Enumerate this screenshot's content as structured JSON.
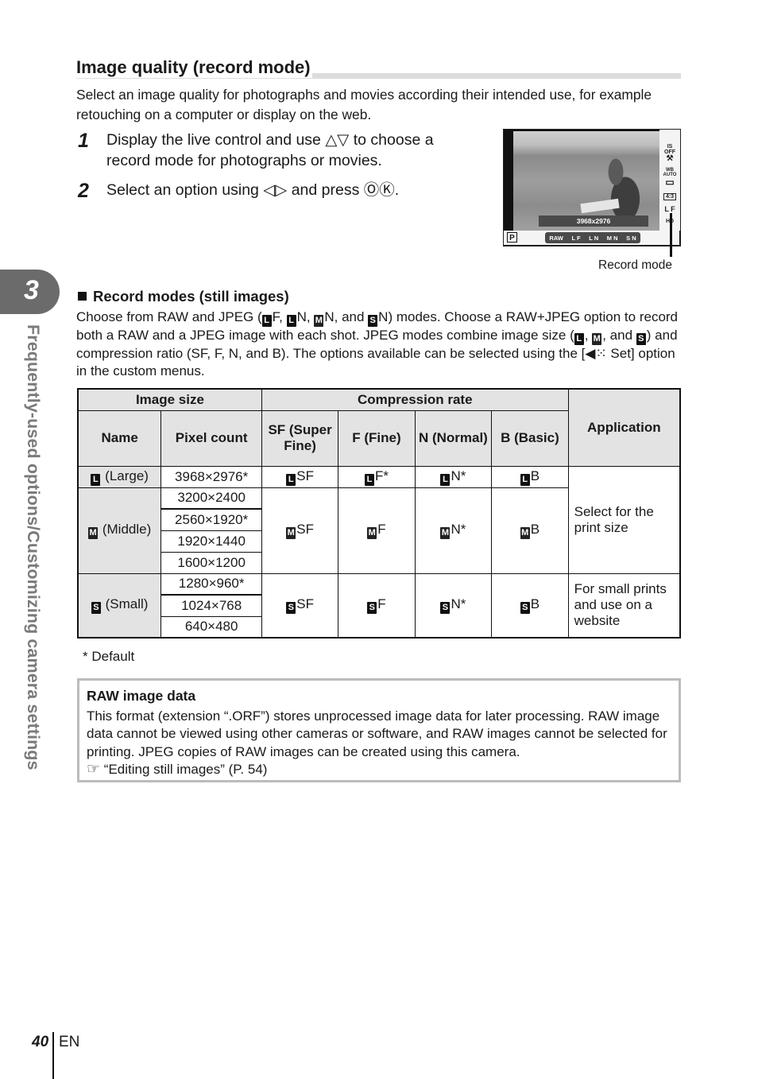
{
  "chapter": {
    "number": "3",
    "title": "Frequently-used options/Customizing camera settings"
  },
  "heading": "Image quality (record mode)",
  "intro": "Select an image quality for photographs and movies according their intended use, for example retouching on a computer or display on the web.",
  "steps": [
    {
      "num": "1",
      "text": "Display the live control and use △▽ to choose a record mode for photographs or movies."
    },
    {
      "num": "2",
      "text": "Select an option using ◁▷ and press ⓄⓀ."
    }
  ],
  "camera_screen": {
    "mode": "P",
    "pixel_readout": "3968x2976",
    "options": [
      "RAW",
      "L F",
      "L N",
      "M N",
      "S N"
    ],
    "right_icons": [
      "IS OFF",
      "⚒",
      "WB AUTO",
      "▭",
      "4:3",
      "L F",
      "HD"
    ],
    "caption": "Record mode"
  },
  "section": {
    "title": "Record modes (still images)",
    "body_parts": {
      "p1": "Choose from RAW and JPEG (",
      "p1b": "F, ",
      "p1c": "N, ",
      "p1d": "N, and ",
      "p1e": "N) modes. Choose a RAW+JPEG option to record both a RAW and a JPEG image with each shot. JPEG modes combine image size (",
      "p2a": ", ",
      "p2b": ", and ",
      "p2c": ") and compression ratio (SF, F, N, and B). The options available can be selected using the [",
      "p2d": "◀⁙ Set] option in the custom menus."
    }
  },
  "table": {
    "group_headers": {
      "image_size": "Image size",
      "compression": "Compression rate",
      "application": "Application"
    },
    "col_headers": {
      "name": "Name",
      "pixel_count": "Pixel count",
      "sf": "SF (Super Fine)",
      "f": "F (Fine)",
      "n": "N (Normal)",
      "b": "B (Basic)"
    },
    "sizes": [
      {
        "icon": "L",
        "name": "(Large)",
        "pixels": [
          "3968×2976*"
        ],
        "sf": "SF",
        "f": "F*",
        "n": "N*",
        "b": "B"
      },
      {
        "icon": "M",
        "name": "(Middle)",
        "pixels": [
          "3200×2400",
          "2560×1920*",
          "1920×1440",
          "1600×1200"
        ],
        "sf": "SF",
        "f": "F",
        "n": "N*",
        "b": "B"
      },
      {
        "icon": "S",
        "name": "(Small)",
        "pixels": [
          "1280×960*",
          "1024×768",
          "640×480"
        ],
        "sf": "SF",
        "f": "F",
        "n": "N*",
        "b": "B"
      }
    ],
    "applications": [
      "Select for the print size",
      "For small prints and use on a website"
    ]
  },
  "footnote": "*  Default",
  "note": {
    "title": "RAW image data",
    "body": "This format (extension “.ORF”) stores unprocessed image data for later processing. RAW image data cannot be viewed using other cameras or software, and RAW images cannot be selected for printing. JPEG copies of RAW images can be created using this camera.",
    "ref_icon": "☞",
    "ref": "“Editing still images” (P. 54)"
  },
  "footer": {
    "page": "40",
    "lang": "EN"
  }
}
